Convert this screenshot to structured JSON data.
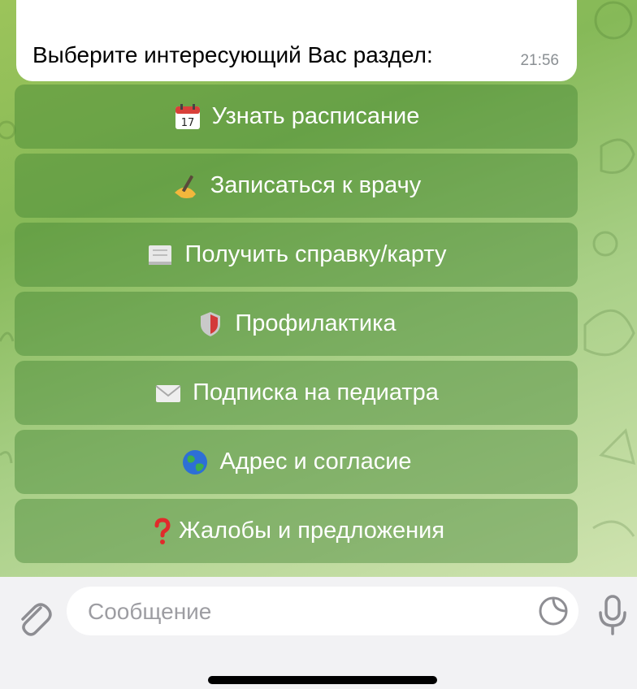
{
  "message": {
    "text": "Выберите интересующий Вас раздел:",
    "time": "21:56"
  },
  "keyboard": [
    {
      "label": "Узнать расписание",
      "icon": "calendar-icon"
    },
    {
      "label": "Записаться к врачу",
      "icon": "writing-hand-icon"
    },
    {
      "label": "Получить справку/карту",
      "icon": "document-icon"
    },
    {
      "label": "Профилактика",
      "icon": "shield-icon"
    },
    {
      "label": "Подписка на педиатра",
      "icon": "envelope-icon"
    },
    {
      "label": "Адрес и согласие",
      "icon": "globe-icon"
    },
    {
      "label": "Жалобы и предложения",
      "icon": "question-mark-icon"
    }
  ],
  "input": {
    "placeholder": "Сообщение"
  },
  "icons": {
    "attach": "paperclip-icon",
    "sticker": "sticker-icon",
    "mic": "microphone-icon"
  },
  "colors": {
    "keyboard_button": "#3e8030",
    "background": "#8fbd5a"
  }
}
